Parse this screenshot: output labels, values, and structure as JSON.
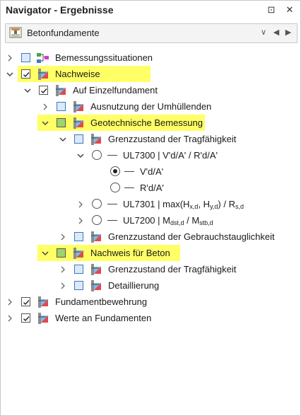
{
  "window": {
    "title": "Navigator - Ergebnisse",
    "pin_glyph": "⊡",
    "close_glyph": "✕"
  },
  "toolbar": {
    "selected_value": "Betonfundamente",
    "dropdown_glyph": "∨",
    "prev_glyph": "◀",
    "next_glyph": "▶"
  },
  "highlight_color": "#ffff66",
  "tree": {
    "bemessungssituationen": "Bemessungssituationen",
    "nachweise": "Nachweise",
    "auf_einzelfundament": "Auf Einzelfundament",
    "ausnutzung": "Ausnutzung der Umhüllenden",
    "geotechnische": "Geotechnische Bemessung",
    "grenzzustand_tragfaehigkeit": "Grenzzustand der Tragfähigkeit",
    "ul7300": "UL7300 | V'd/A' / R'd/A'",
    "vd": "V'd/A'",
    "rd": "R'd/A'",
    "ul7301_pre": "UL7301 | max(H",
    "ul7301_s1": "x,d",
    "ul7301_mid": ", H",
    "ul7301_s2": "y,d",
    "ul7301_mid2": ") / R",
    "ul7301_s3": "s,d",
    "ul7200_pre": "UL7200 | M",
    "ul7200_s1": "dst,d",
    "ul7200_mid": " / M",
    "ul7200_s2": "stb,d",
    "grenzzustand_gebrauch": "Grenzzustand der Gebrauchstauglichkeit",
    "nachweis_beton": "Nachweis für Beton",
    "grenzzustand_tragfaehigkeit2": "Grenzzustand der Tragfähigkeit",
    "detaillierung": "Detaillierung",
    "fundamentbewehrung": "Fundamentbewehrung",
    "werte": "Werte an Fundamenten"
  }
}
